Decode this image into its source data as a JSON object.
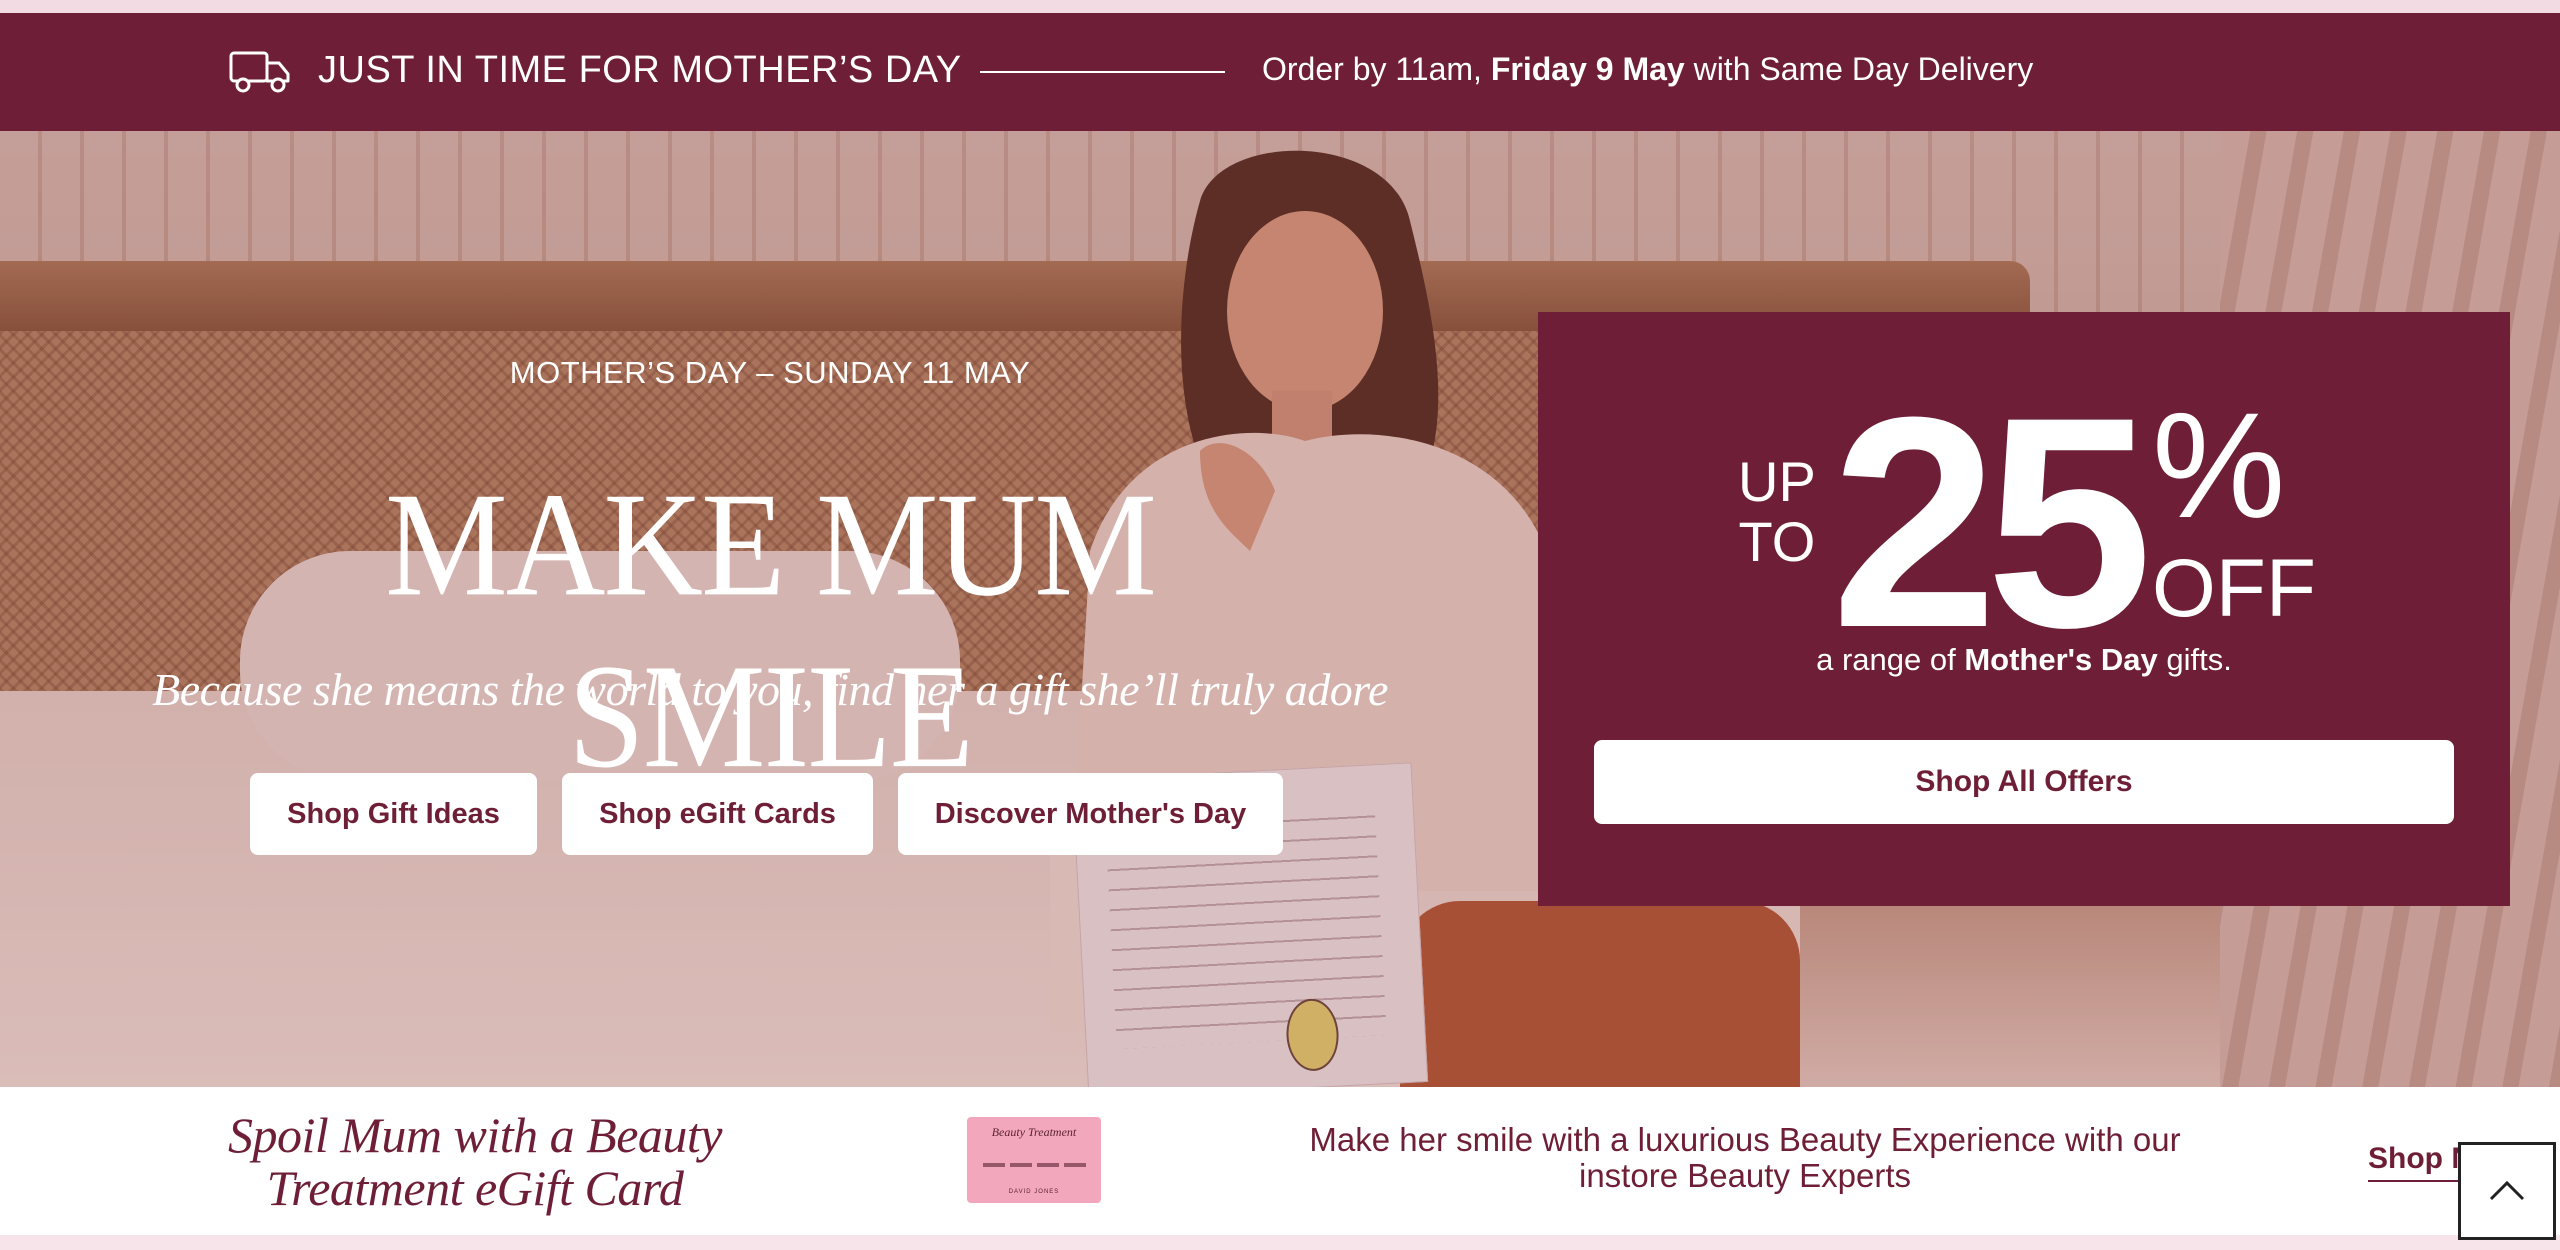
{
  "delivery_banner": {
    "headline": "JUST IN TIME FOR MOTHER’S DAY",
    "order_prefix": "Order by 11am, ",
    "order_date": "Friday 9 May",
    "order_suffix": " with Same Day Delivery",
    "icon": "delivery-truck-icon"
  },
  "hero": {
    "eyebrow": "MOTHER’S DAY – SUNDAY 11 MAY",
    "title": "MAKE MUM SMILE",
    "subtitle": "Because she means the world to you, find her a gift she’ll truly adore",
    "buttons": {
      "gift_ideas": "Shop Gift Ideas",
      "egift_cards": "Shop eGift Cards",
      "discover": "Discover Mother's Day"
    }
  },
  "offer": {
    "up": "UP",
    "to": "TO",
    "amount": "25",
    "percent": "%",
    "off": "OFF",
    "caption_prefix": "a range of ",
    "caption_bold": "Mother's Day",
    "caption_suffix": " gifts.",
    "button": "Shop All Offers"
  },
  "promo": {
    "heading_line1": "Spoil Mum with a Beauty",
    "heading_line2": "Treatment eGift Card",
    "card_title": "Beauty Treatment",
    "card_brand": "DAVID JONES",
    "text": "Make her smile with a luxurious Beauty Experience with our instore Beauty Experts",
    "link": "Shop Now"
  },
  "back_to_top": {
    "icon": "chevron-up-icon"
  },
  "colors": {
    "brand": "#6e1f37",
    "background": "#f6e4ea",
    "button_bg": "#ffffff"
  }
}
